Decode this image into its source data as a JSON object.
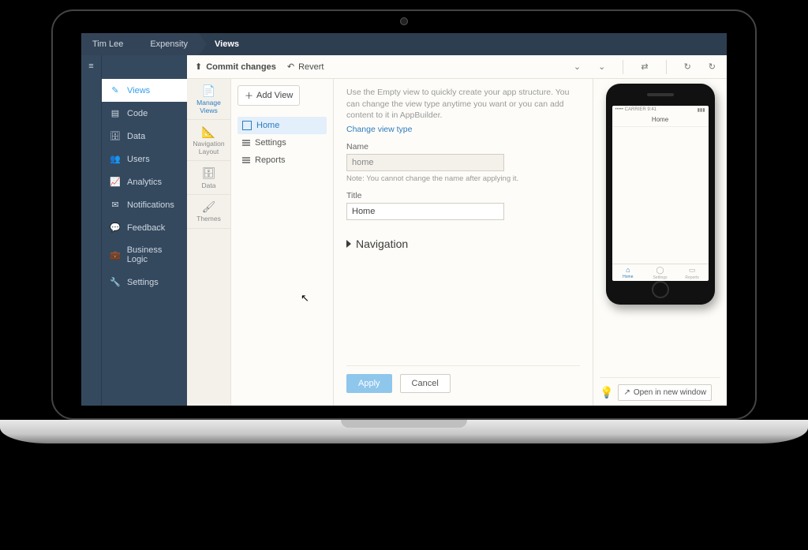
{
  "breadcrumbs": [
    "Tim Lee",
    "Expensity",
    "Views"
  ],
  "toolbar": {
    "commit": "Commit changes",
    "revert": "Revert"
  },
  "sidebar": {
    "items": [
      {
        "icon": "✎",
        "label": "Views",
        "active": true
      },
      {
        "icon": "▤",
        "label": "Code"
      },
      {
        "icon": "🗄",
        "label": "Data"
      },
      {
        "icon": "👥",
        "label": "Users"
      },
      {
        "icon": "📈",
        "label": "Analytics"
      },
      {
        "icon": "✉",
        "label": "Notifications"
      },
      {
        "icon": "💬",
        "label": "Feedback"
      },
      {
        "icon": "💼",
        "label": "Business Logic"
      },
      {
        "icon": "🔧",
        "label": "Settings"
      }
    ]
  },
  "secnav": [
    {
      "icon": "📄",
      "label": "Manage Views",
      "active": true
    },
    {
      "icon": "📐",
      "label": "Navigation Layout"
    },
    {
      "icon": "🗄",
      "label": "Data"
    },
    {
      "icon": "🖌",
      "label": "Themes"
    }
  ],
  "viewlist": {
    "add_label": "Add View",
    "items": [
      {
        "label": "Home",
        "active": true,
        "type": "empty"
      },
      {
        "label": "Settings",
        "type": "list"
      },
      {
        "label": "Reports",
        "type": "list"
      }
    ]
  },
  "form": {
    "help": "Use the Empty view to quickly create your app structure. You can change the view type anytime you want or you can add content to it in AppBuilder.",
    "change_link": "Change view type",
    "name_label": "Name",
    "name_value": "home",
    "name_note": "Note: You cannot change the name after applying it.",
    "title_label": "Title",
    "title_value": "Home",
    "nav_section": "Navigation",
    "apply": "Apply",
    "cancel": "Cancel"
  },
  "preview": {
    "status_left": "••••• CARRIER  9:41",
    "status_right": "▮▮▮",
    "title": "Home",
    "tabs": [
      {
        "icon": "⌂",
        "label": "Home",
        "active": true
      },
      {
        "icon": "◯",
        "label": "Settings"
      },
      {
        "icon": "▭",
        "label": "Reports"
      }
    ],
    "open_new": "Open in new window"
  }
}
